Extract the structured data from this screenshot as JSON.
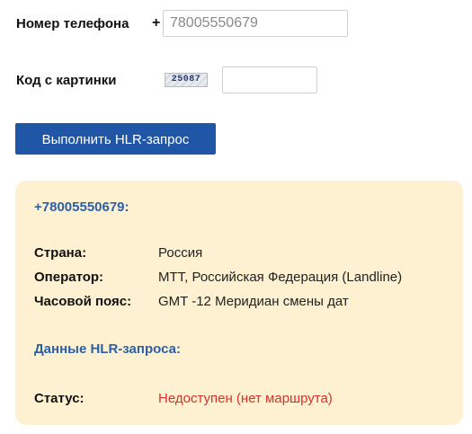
{
  "form": {
    "phone_label": "Номер телефона",
    "plus_sign": "+",
    "phone_value": "78005550679",
    "captcha_label": "Код с картинки",
    "captcha_text": "25087",
    "captcha_value": "",
    "submit_label": "Выполнить HLR-запрос"
  },
  "result": {
    "number": "+78005550679:",
    "rows": [
      {
        "key": "Страна:",
        "value": "Россия"
      },
      {
        "key": "Оператор:",
        "value": "МТТ, Российская Федерация (Landline)"
      },
      {
        "key": "Часовой пояс:",
        "value": "GMT -12 Меридиан смены дат"
      }
    ],
    "hlr_title": "Данные HLR-запроса:",
    "status": {
      "key": "Статус:",
      "value": "Недоступен (нет маршрута)"
    }
  },
  "colors": {
    "button": "#1f56a6",
    "panel": "#fdf1d1",
    "accent": "#2d5fa6",
    "error": "#d9302a"
  }
}
